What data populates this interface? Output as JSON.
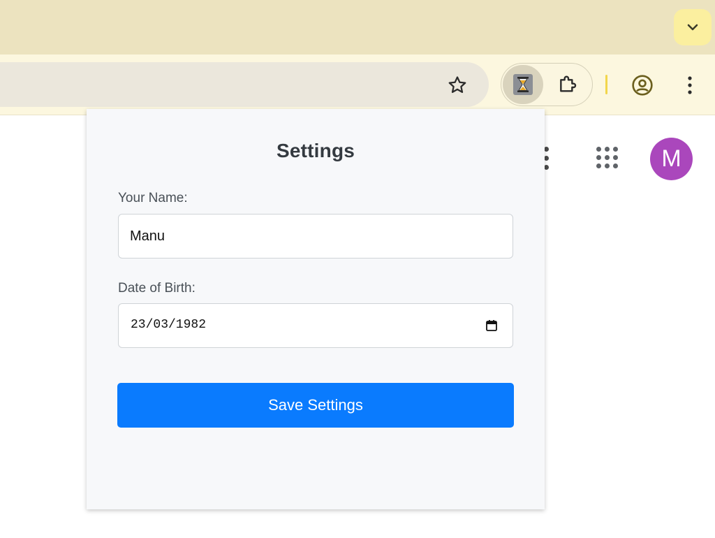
{
  "browser": {
    "icons": {
      "tab_search": "chevron-down-icon",
      "bookmark": "star-icon",
      "active_extension": "hourglass-icon",
      "extensions_menu": "puzzle-icon",
      "profile": "account-circle-icon",
      "browser_menu": "vertical-dots-icon"
    },
    "colors": {
      "tabstrip": "#ece3bf",
      "toolbar": "#fcf7df",
      "tab_search_button": "#fbef9f"
    }
  },
  "page": {
    "icons": {
      "more": "vertical-dots-icon",
      "apps": "apps-grid-icon"
    },
    "avatar_initial": "M",
    "avatar_color": "#aa47bc"
  },
  "popup": {
    "title": "Settings",
    "name_label": "Your Name:",
    "name_value": "Manu",
    "dob_label": "Date of Birth:",
    "dob_value": "23/03/1982",
    "calendar_icon": "calendar-icon",
    "save_label": "Save Settings",
    "colors": {
      "background": "#f7f8fa",
      "button": "#0a7bfe",
      "title": "#343a40"
    }
  }
}
